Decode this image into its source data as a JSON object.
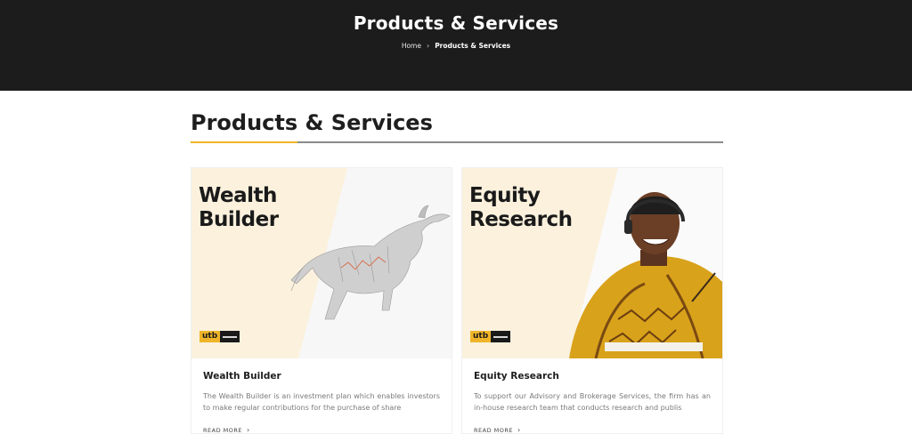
{
  "hero": {
    "title": "Products & Services",
    "breadcrumb": {
      "home": "Home",
      "separator": "›",
      "current": "Products & Services"
    }
  },
  "section": {
    "title": "Products & Services",
    "accent_color": "#f0b429"
  },
  "cards": [
    {
      "image_heading_line1": "Wealth",
      "image_heading_line2": "Builder",
      "brand_mark": "utb",
      "title": "Wealth Builder",
      "description": "The Wealth Builder is an investment plan which enables investors to make regular contributions for the purchase of share",
      "read_more": "READ MORE",
      "arrow": "›"
    },
    {
      "image_heading_line1": "Equity",
      "image_heading_line2": "Research",
      "brand_mark": "utb",
      "title": "Equity Research",
      "description": "To support our Advisory and Brokerage Services, the firm has an in-house research team that conducts research and publis",
      "read_more": "READ MORE",
      "arrow": "›"
    }
  ]
}
